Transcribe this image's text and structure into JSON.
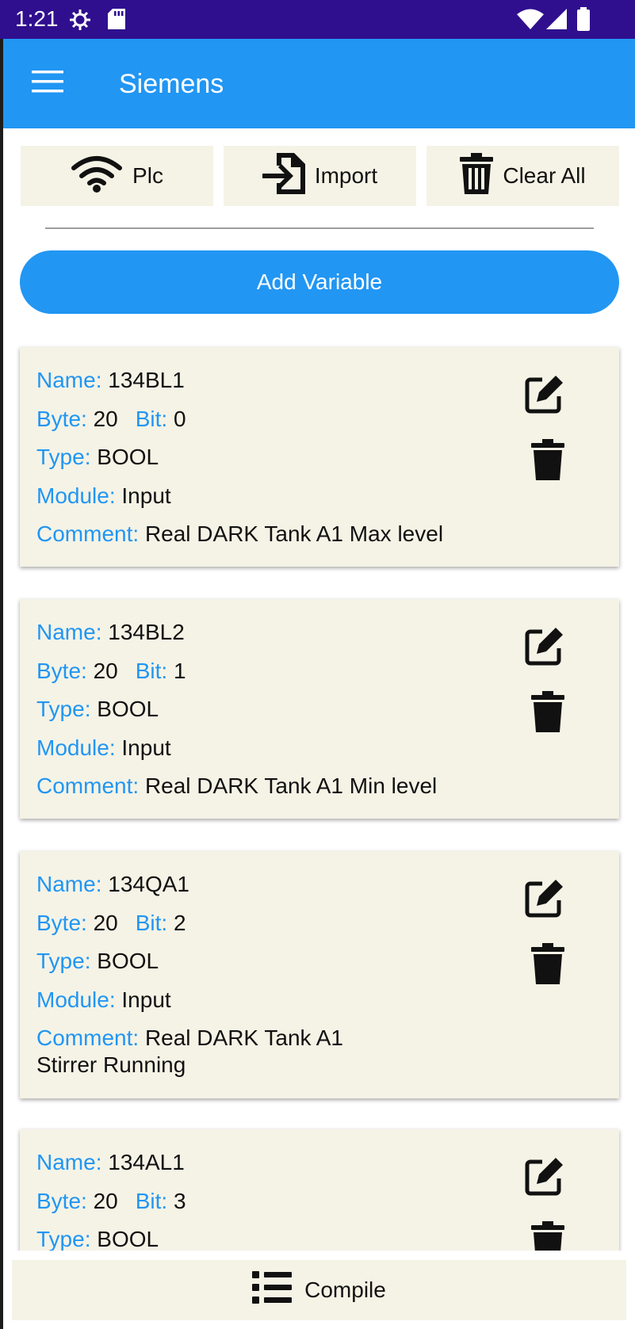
{
  "status_bar": {
    "time": "1:21"
  },
  "app_bar": {
    "title": "Siemens"
  },
  "toolbar": {
    "plc_label": "Plc",
    "import_label": "Import",
    "clear_all_label": "Clear All"
  },
  "add_variable_label": "Add Variable",
  "labels": {
    "name": "Name:",
    "byte": "Byte:",
    "bit": "Bit:",
    "type": "Type:",
    "module": "Module:",
    "comment": "Comment:"
  },
  "variables": [
    {
      "name": "134BL1",
      "byte": "20",
      "bit": "0",
      "type": "BOOL",
      "module": "Input",
      "comment": "Real DARK Tank A1 Max level"
    },
    {
      "name": "134BL2",
      "byte": "20",
      "bit": "1",
      "type": "BOOL",
      "module": "Input",
      "comment": "Real DARK Tank A1 Min level"
    },
    {
      "name": "134QA1",
      "byte": "20",
      "bit": "2",
      "type": "BOOL",
      "module": "Input",
      "comment": "Real DARK Tank A1 Stirrer Running"
    },
    {
      "name": "134AL1",
      "byte": "20",
      "bit": "3",
      "type": "BOOL"
    }
  ],
  "compile_label": "Compile"
}
